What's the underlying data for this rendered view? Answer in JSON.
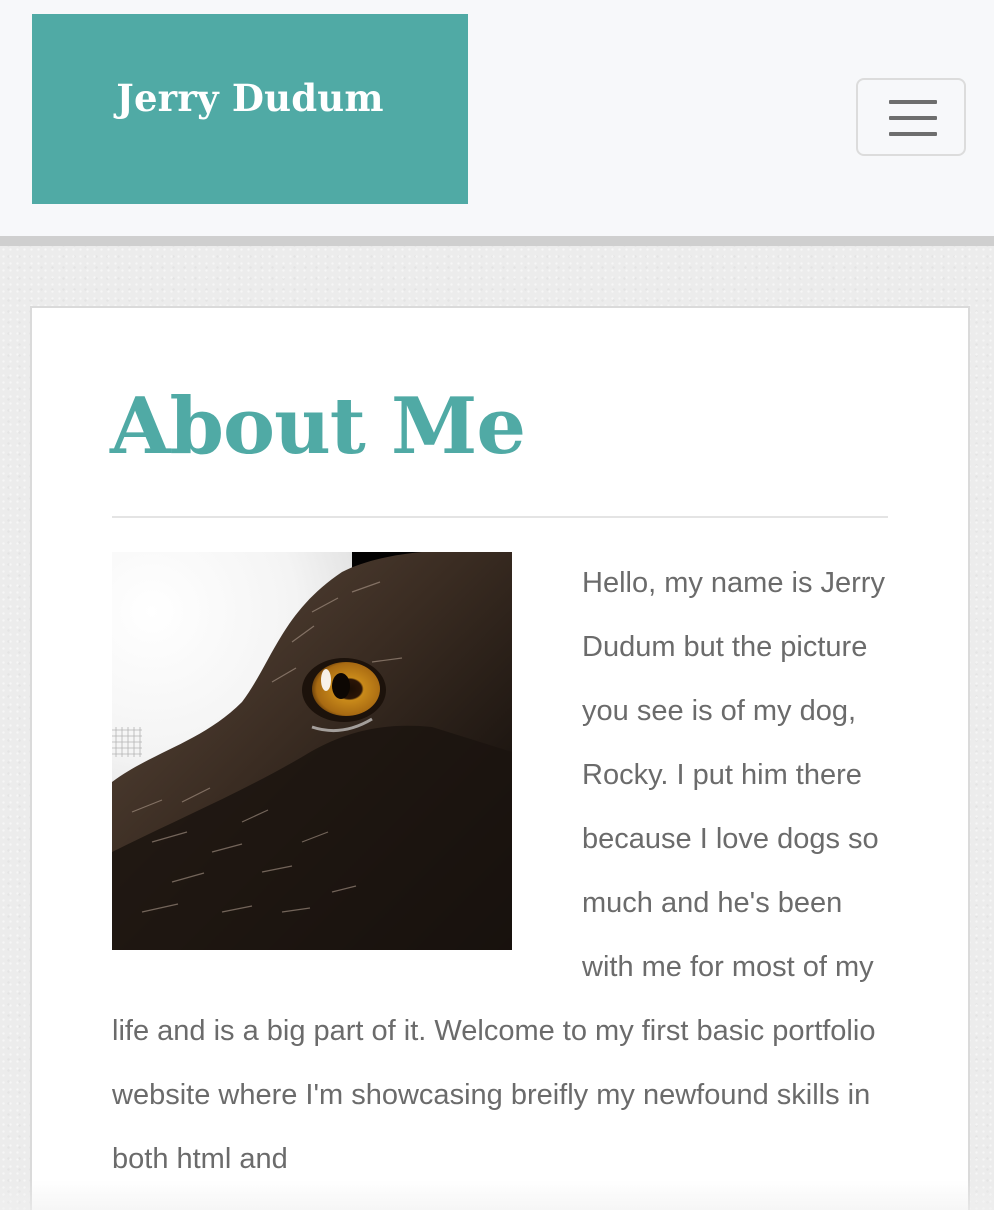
{
  "navbar": {
    "brand": "Jerry Dudum",
    "toggler_icon": "hamburger-menu-icon"
  },
  "about": {
    "title": "About Me",
    "photo_alt": "Close-up of a dog's amber eye",
    "bio": "Hello, my name is Jerry Dudum but the picture you see is of my dog, Rocky. I put him there because I love dogs so much and he's been with me for most of my life and is a big part of it. Welcome to my first basic portfolio website where I'm showcasing breifly my newfound skills in both html and"
  },
  "colors": {
    "accent": "#50aaa5",
    "text": "#6b6b6b",
    "navbar_bg": "#f7f8fa"
  }
}
